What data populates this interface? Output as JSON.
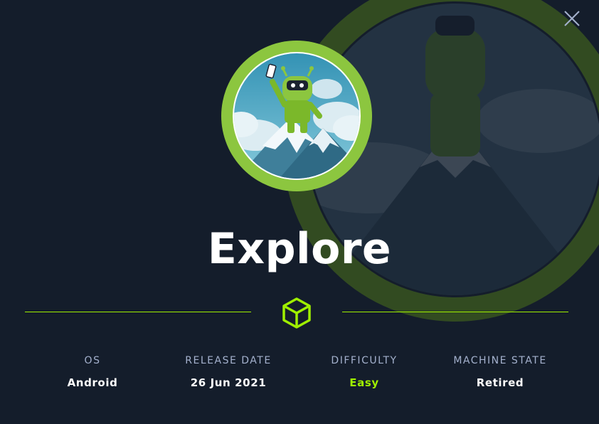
{
  "machine": {
    "name": "Explore"
  },
  "stats": [
    {
      "label": "OS",
      "value": "Android"
    },
    {
      "label": "RELEASE DATE",
      "value": "26 Jun 2021"
    },
    {
      "label": "DIFFICULTY",
      "value": "Easy"
    },
    {
      "label": "MACHINE STATE",
      "value": "Retired"
    }
  ],
  "colors": {
    "background": "#141d2b",
    "accent": "#9fef00",
    "label": "#a4b1cd",
    "text": "#ffffff"
  },
  "icons": {
    "close": "close-icon",
    "machine": "cube-icon"
  }
}
